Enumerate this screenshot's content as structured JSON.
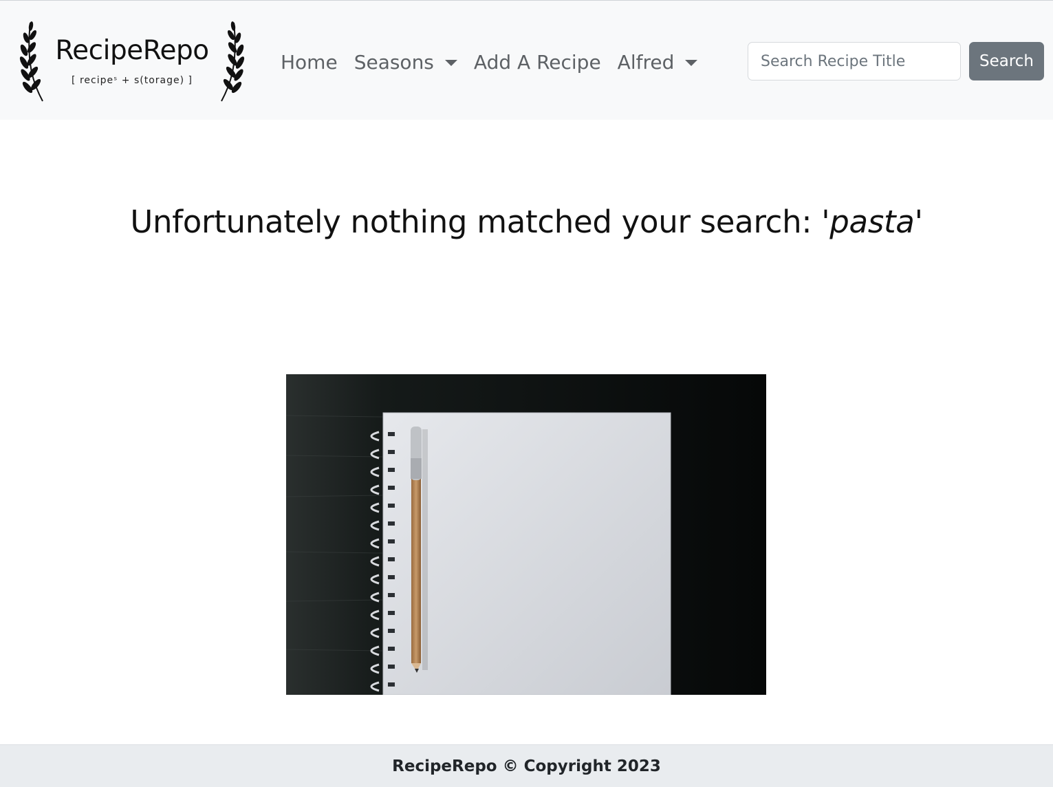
{
  "brand": {
    "name": "RecipeRepo",
    "tagline": "[ recipeˢ + s(torage) ]"
  },
  "nav": {
    "home": "Home",
    "seasons": "Seasons",
    "add_recipe": "Add A Recipe",
    "user": "Alfred"
  },
  "search": {
    "placeholder": "Search Recipe Title",
    "value": "",
    "button_label": "Search"
  },
  "result": {
    "message": "Unfortunately nothing matched your search: '",
    "query": "pasta",
    "closing_quote": "'"
  },
  "illustration": {
    "icon": "empty-notebook-with-pencil"
  },
  "footer": {
    "text": "RecipeRepo © Copyright 2023"
  },
  "colors": {
    "navbar_bg": "#f8f9fa",
    "nav_link": "#5d6165",
    "search_button_bg": "#6c757d",
    "footer_bg": "#e9ecef"
  }
}
